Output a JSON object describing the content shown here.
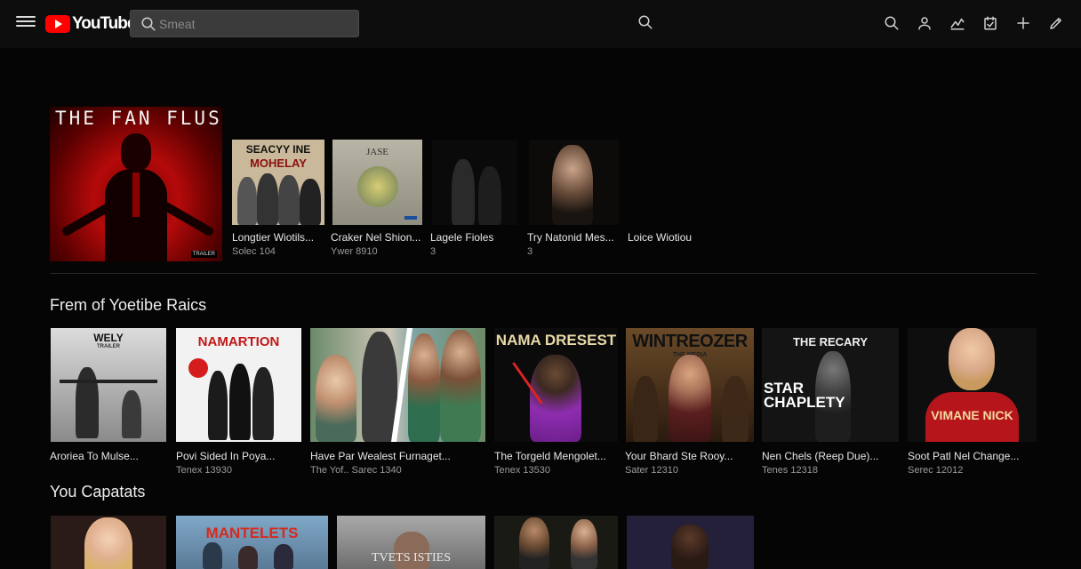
{
  "header": {
    "logo_text": "YouTube",
    "search_placeholder": "Smeat",
    "icons": [
      "menu-icon",
      "search-icon",
      "search-icon",
      "user-icon",
      "broadcast-icon",
      "calendar-icon",
      "plus-icon",
      "pencil-icon"
    ]
  },
  "hero": {
    "title": "THE FAN FLUS",
    "badge": "TRAILER"
  },
  "row1": {
    "items": [
      {
        "poster_text_1": "SEACYY INE",
        "poster_text_2": "MOHELAY",
        "title": "Longtier Wiotils...",
        "sub": "Solec 104"
      },
      {
        "poster_text_1": "JASE",
        "poster_text_2": "",
        "title": "Craker Nel Shion...",
        "sub": "Ywer 8910"
      },
      {
        "poster_text_1": "",
        "poster_text_2": "",
        "title": "Lagele Fioles",
        "sub": "3"
      },
      {
        "poster_text_1": "",
        "poster_text_2": "",
        "title": "Try Natonid Mes...",
        "sub": "3"
      },
      {
        "poster_text_1": "",
        "poster_text_2": "",
        "title": "Loice Wiotiou",
        "sub": ""
      }
    ]
  },
  "section2": {
    "title": "Frem of Yoetibe Raics",
    "items": [
      {
        "poster_text": "WELY",
        "poster_sub": "TRAILER",
        "title": "Aroriea To Mulse...",
        "sub": ""
      },
      {
        "poster_text": "NAMARTION",
        "poster_sub": "",
        "title": "Povi Sided In Poya...",
        "sub": "Tenex 13930"
      },
      {
        "poster_text": "",
        "poster_sub": "",
        "title": "Have Par Wealest Furnaget...",
        "sub": "The Yof.. Sarec 1340"
      },
      {
        "poster_text": "NAMA DRESEST",
        "poster_sub": "",
        "title": "The Torgeld Mengolet...",
        "sub": "Tenex 13530"
      },
      {
        "poster_text": "WINTREOZER",
        "poster_sub": "THE MEDIA",
        "title": "Your Bhard Ste Rooy...",
        "sub": "Sater 12310"
      },
      {
        "poster_text": "THE RECARY",
        "poster_sub": "STAR CHAPLETY",
        "title": "Nen Chels (Reep Due)...",
        "sub": "Tenes 12318"
      },
      {
        "poster_text": "VIMANE NICK",
        "poster_sub": "",
        "title": "Soot Patl Nel Change...",
        "sub": "Serec 12012"
      }
    ]
  },
  "section3": {
    "title": "You Capatats",
    "items": [
      {
        "poster_text": ""
      },
      {
        "poster_text": "MANTELETS"
      },
      {
        "poster_text": "TVETS ISTIES"
      },
      {
        "poster_text": ""
      },
      {
        "poster_text": ""
      }
    ]
  }
}
